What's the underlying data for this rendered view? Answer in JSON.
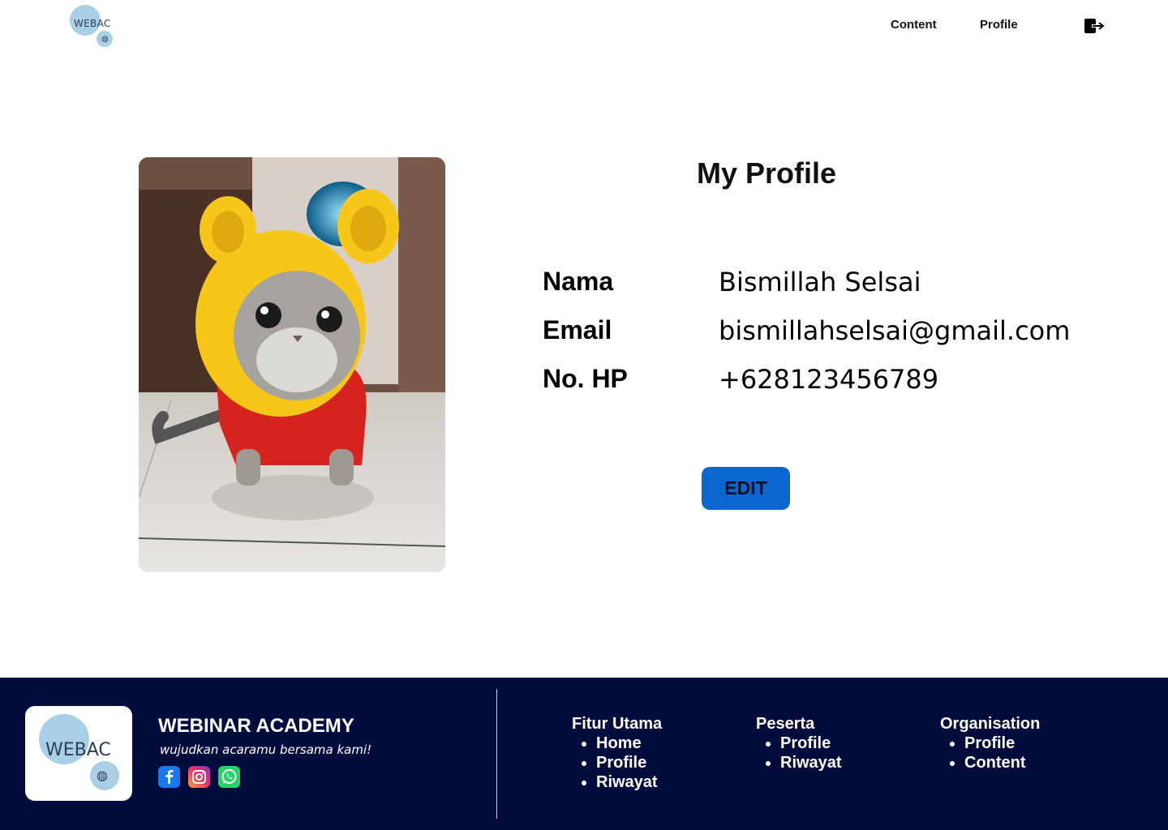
{
  "header": {
    "logo_text": "WEBAC",
    "nav": {
      "content": "Content",
      "profile": "Profile"
    },
    "logout_icon": "logout-icon"
  },
  "profile": {
    "title": "My Profile",
    "photo": "cat-in-yellow-hood-photo",
    "fields": [
      {
        "label": "Nama",
        "value": "Bismillah Selsai"
      },
      {
        "label": "Email",
        "value": "bismillahselsai@gmail.com"
      },
      {
        "label": "No. HP",
        "value": "+628123456789"
      }
    ],
    "edit_label": "EDIT"
  },
  "footer": {
    "logo_text": "WEBAC",
    "brand": "WEBINAR ACADEMY",
    "tagline": "wujudkan acaramu bersama kami!",
    "social": [
      "facebook-icon",
      "instagram-icon",
      "whatsapp-icon"
    ],
    "columns": [
      {
        "heading": "Fitur Utama",
        "items": [
          "Home",
          "Profile",
          "Riwayat"
        ]
      },
      {
        "heading": "Peserta",
        "items": [
          "Profile",
          "Riwayat"
        ]
      },
      {
        "heading": "Organisation",
        "items": [
          "Profile",
          "Content"
        ]
      }
    ]
  },
  "colors": {
    "footer_bg": "#020d3d",
    "button_bg": "#0b66d0",
    "logo_circle": "#a9cfe6"
  }
}
